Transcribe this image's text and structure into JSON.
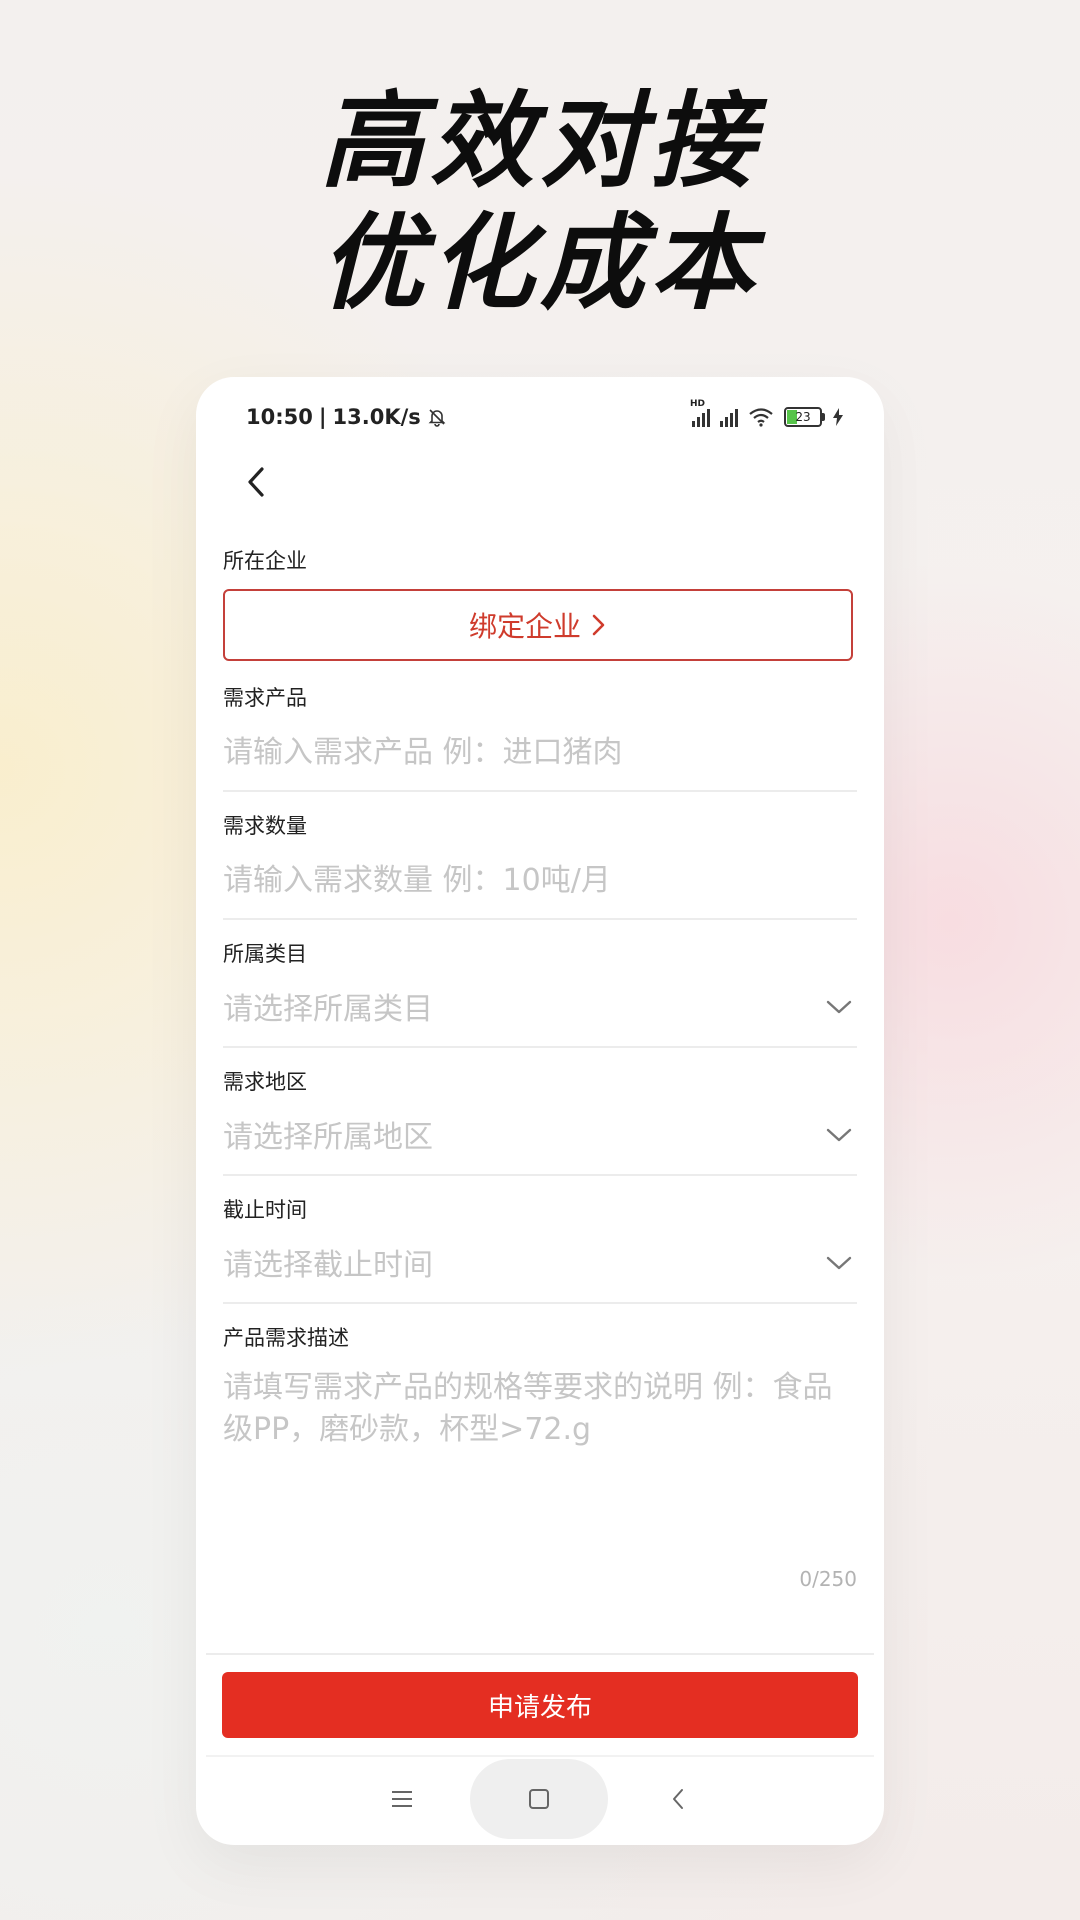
{
  "headline": {
    "line1": "高效对接",
    "line2": "优化成本"
  },
  "status_bar": {
    "time": "10:50",
    "separator": "|",
    "speed": "13.0K/s",
    "battery": "23",
    "hd_label": "HD"
  },
  "form": {
    "company": {
      "label": "所在企业",
      "button": "绑定企业"
    },
    "product": {
      "label": "需求产品",
      "placeholder": "请输入需求产品 例：进口猪肉"
    },
    "quantity": {
      "label": "需求数量",
      "placeholder": "请输入需求数量 例：10吨/月"
    },
    "category": {
      "label": "所属类目",
      "placeholder": "请选择所属类目"
    },
    "region": {
      "label": "需求地区",
      "placeholder": "请选择所属地区"
    },
    "deadline": {
      "label": "截止时间",
      "placeholder": "请选择截止时间"
    },
    "description": {
      "label": "产品需求描述",
      "placeholder": "请填写需求产品的规格等要求的说明 例：食品级PP，磨砂款，杯型>72.g",
      "counter": "0/250"
    },
    "submit": "申请发布"
  },
  "colors": {
    "accent": "#e42e22",
    "border_accent": "#c4403a",
    "placeholder": "#c6c6c6"
  },
  "icons": [
    "back-arrow-icon",
    "chevron-right-icon",
    "chevron-down-icon",
    "bell-off-icon",
    "wifi-icon",
    "battery-icon",
    "charging-icon",
    "menu-icon",
    "home-icon",
    "nav-back-icon"
  ]
}
